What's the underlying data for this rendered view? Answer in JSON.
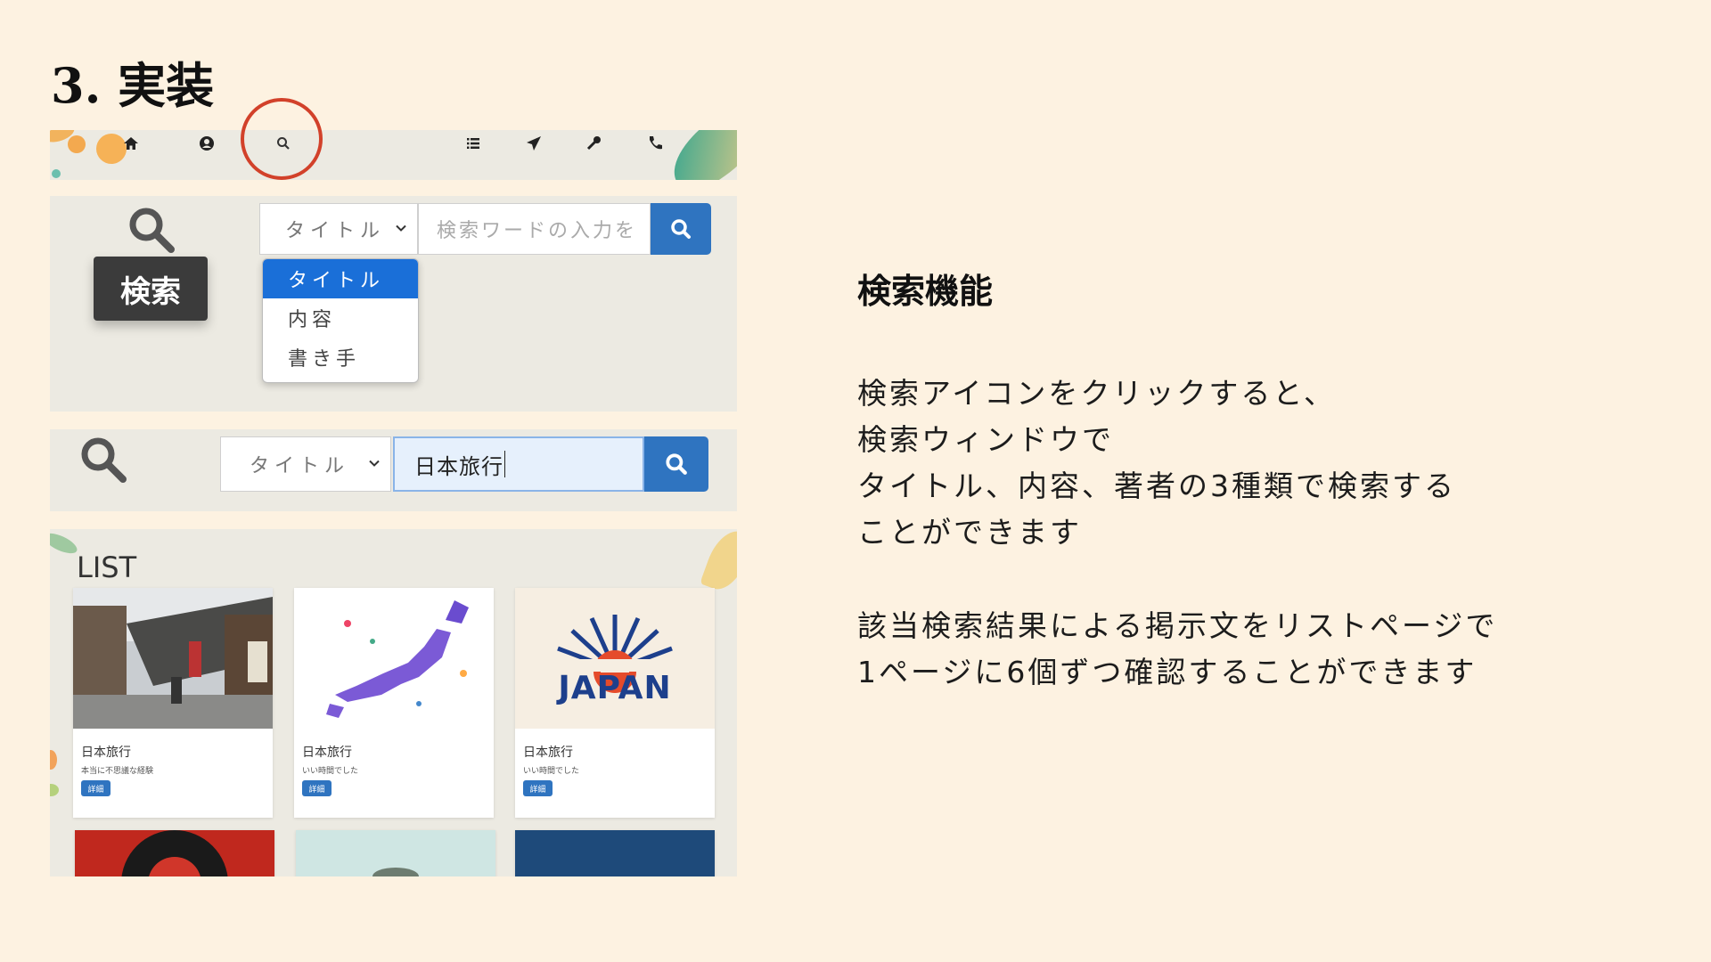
{
  "slide": {
    "title": "3. 実装"
  },
  "navbar": {
    "icons": [
      "home-icon",
      "user-circle-icon",
      "search-icon",
      "list-icon",
      "paper-plane-icon",
      "key-icon",
      "phone-icon"
    ]
  },
  "search_window": {
    "tooltip": "検索",
    "select_value": "タイトル",
    "input_placeholder": "検索ワードの入力を",
    "dropdown_options": [
      "タイトル",
      "内容",
      "書き手"
    ],
    "selected_option": "タイトル"
  },
  "search_window_filled": {
    "select_value": "タイトル",
    "input_value": "日本旅行"
  },
  "list": {
    "title": "LIST",
    "cards": [
      {
        "title": "日本旅行",
        "subtitle": "本当に不思議な経験",
        "button": "詳細"
      },
      {
        "title": "日本旅行",
        "subtitle": "いい時間でした",
        "button": "詳細"
      },
      {
        "title": "日本旅行",
        "subtitle": "いい時間でした",
        "button": "詳細"
      }
    ],
    "japan_logo_text": "JAPAN"
  },
  "description": {
    "heading": "検索機能",
    "paragraph1": [
      "検索アイコンをクリックすると、",
      "検索ウィンドウで",
      "タイトル、内容、著者の3種類で検索する",
      "ことができます"
    ],
    "paragraph2": [
      "該当検索結果による掲示文をリストページで",
      "1ページに6個ずつ確認することができます"
    ]
  },
  "colors": {
    "background": "#fdf2e1",
    "accent_blue": "#2f74c0",
    "highlight_red": "#d2412a"
  }
}
